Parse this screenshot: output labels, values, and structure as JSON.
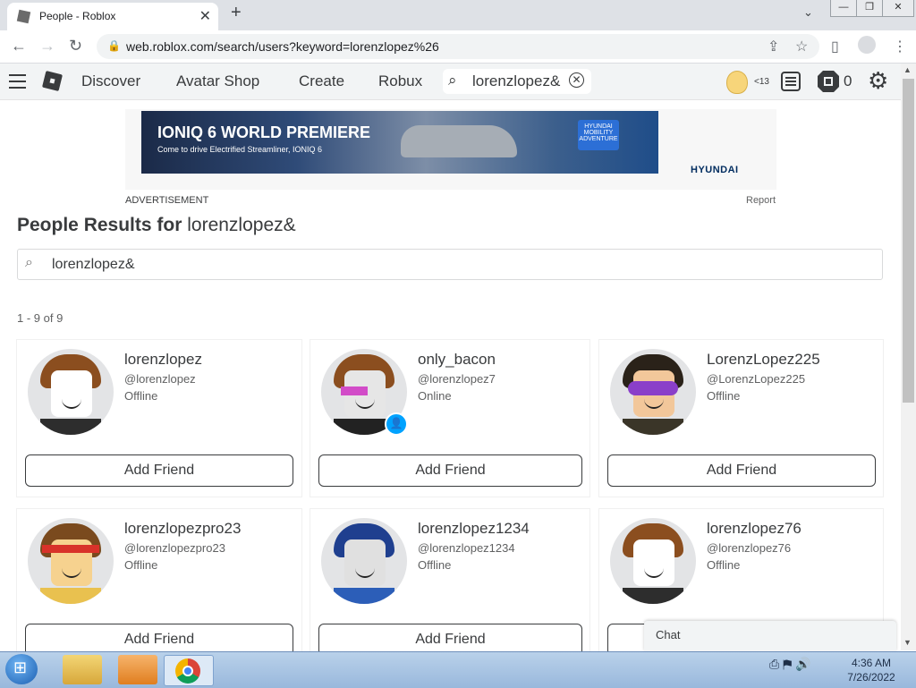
{
  "browser": {
    "tab_title": "People - Roblox",
    "new_tab": "+",
    "url": "web.roblox.com/search/users?keyword=lorenzlopez%26"
  },
  "nav": {
    "links": [
      "Discover",
      "Avatar Shop",
      "Create",
      "Robux"
    ],
    "search_value": "lorenzlopez&",
    "age_badge": "<13",
    "robux_count": "0"
  },
  "ad": {
    "headline": "IONIQ 6 WORLD PREMIERE",
    "subline": "Come to drive Electrified Streamliner, IONIQ 6",
    "badge": "HYUNDAI MOBILITY ADVENTURE",
    "brand": "HYUNDAI",
    "label": "ADVERTISEMENT",
    "report": "Report"
  },
  "results": {
    "heading_prefix": "People Results for",
    "heading_query": "lorenzlopez&",
    "search_value": "lorenzlopez&",
    "count_text": "1 - 9 of 9",
    "add_friend_label": "Add Friend",
    "users": [
      {
        "name": "lorenzlopez",
        "handle": "@lorenzlopez",
        "status": "Offline"
      },
      {
        "name": "only_bacon",
        "handle": "@lorenzlopez7",
        "status": "Online"
      },
      {
        "name": "LorenzLopez225",
        "handle": "@LorenzLopez225",
        "status": "Offline"
      },
      {
        "name": "lorenzlopezpro23",
        "handle": "@lorenzlopezpro23",
        "status": "Offline"
      },
      {
        "name": "lorenzlopez1234",
        "handle": "@lorenzlopez1234",
        "status": "Offline"
      },
      {
        "name": "lorenzlopez76",
        "handle": "@lorenzlopez76",
        "status": "Offline"
      }
    ]
  },
  "chat": {
    "label": "Chat"
  },
  "taskbar": {
    "time": "4:36 AM",
    "date": "7/26/2022"
  },
  "colors": {
    "accent": "#00a2ff",
    "text": "#393b3d",
    "nav_bg": "#f2f4f5"
  }
}
